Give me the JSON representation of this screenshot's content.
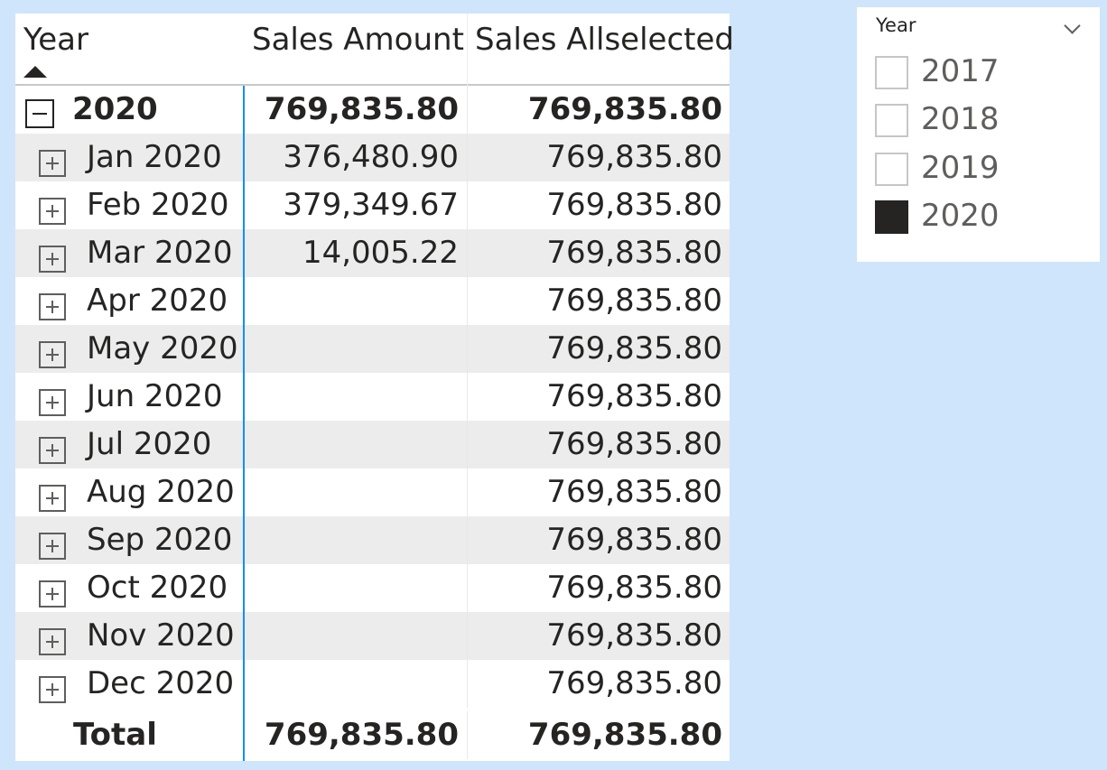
{
  "matrix": {
    "columns": {
      "year": "Year",
      "sales_amount": "Sales Amount",
      "sales_allselected": "Sales Allselected"
    },
    "sort_indicator": "sort-ascending-icon",
    "year_row": {
      "label": "2020",
      "sales_amount": "769,835.80",
      "sales_allselected": "769,835.80"
    },
    "months": [
      {
        "label": "Jan 2020",
        "sales_amount": "376,480.90",
        "sales_allselected": "769,835.80"
      },
      {
        "label": "Feb 2020",
        "sales_amount": "379,349.67",
        "sales_allselected": "769,835.80"
      },
      {
        "label": "Mar 2020",
        "sales_amount": "14,005.22",
        "sales_allselected": "769,835.80"
      },
      {
        "label": "Apr 2020",
        "sales_amount": "",
        "sales_allselected": "769,835.80"
      },
      {
        "label": "May 2020",
        "sales_amount": "",
        "sales_allselected": "769,835.80"
      },
      {
        "label": "Jun 2020",
        "sales_amount": "",
        "sales_allselected": "769,835.80"
      },
      {
        "label": "Jul 2020",
        "sales_amount": "",
        "sales_allselected": "769,835.80"
      },
      {
        "label": "Aug 2020",
        "sales_amount": "",
        "sales_allselected": "769,835.80"
      },
      {
        "label": "Sep 2020",
        "sales_amount": "",
        "sales_allselected": "769,835.80"
      },
      {
        "label": "Oct 2020",
        "sales_amount": "",
        "sales_allselected": "769,835.80"
      },
      {
        "label": "Nov 2020",
        "sales_amount": "",
        "sales_allselected": "769,835.80"
      },
      {
        "label": "Dec 2020",
        "sales_amount": "",
        "sales_allselected": "769,835.80"
      }
    ],
    "total_row": {
      "label": "Total",
      "sales_amount": "769,835.80",
      "sales_allselected": "769,835.80"
    }
  },
  "slicer": {
    "title": "Year",
    "chevron": "chevron-down-icon",
    "items": [
      {
        "label": "2017",
        "checked": false
      },
      {
        "label": "2018",
        "checked": false
      },
      {
        "label": "2019",
        "checked": false
      },
      {
        "label": "2020",
        "checked": true
      }
    ]
  },
  "colors": {
    "background": "#cfe5fb",
    "row_alt": "#ececec",
    "row_separator": "#118dff",
    "text": "#252423",
    "checked": "#252423"
  }
}
